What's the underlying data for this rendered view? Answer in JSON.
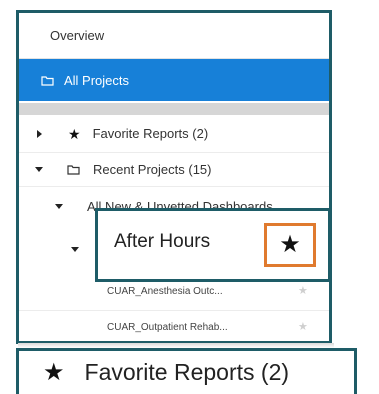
{
  "nav": {
    "overview_label": "Overview",
    "all_projects_label": "All Projects",
    "all_projects_icon": "folder-icon"
  },
  "tree": {
    "favorite_reports_label": "Favorite Reports (2)",
    "recent_projects_label": "Recent Projects (15)",
    "unvetted_label": "All New & Unvetted Dashboards"
  },
  "reports": [
    {
      "label": "CUAR_Anesthesia Outc..."
    },
    {
      "label": "CUAR_Outpatient Rehab..."
    }
  ],
  "callouts": {
    "after_hours_label": "After Hours",
    "favorite_reports_zoom_label": "Favorite Reports (2)"
  },
  "colors": {
    "active_nav_bg": "#1780d8",
    "callout_border": "#1e5c67",
    "star_highlight_border": "#e07a2e"
  }
}
